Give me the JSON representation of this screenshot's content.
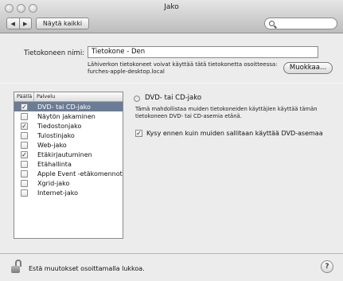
{
  "window": {
    "title": "Jako"
  },
  "toolbar": {
    "back_icon": "◀",
    "forward_icon": "▶",
    "show_all_label": "Näytä kaikki",
    "search_placeholder": ""
  },
  "computer_name": {
    "label": "Tietokoneen nimi:",
    "value": "Tietokone - Den",
    "help_line1": "Lähiverkon tietokoneet voivat käyttää tätä tietokonetta osoitteessa:",
    "help_line2": "furches-apple-desktop.local",
    "edit_label": "Muokkaa..."
  },
  "services": {
    "col_on": "Päällä",
    "col_service": "Palvelu",
    "items": [
      {
        "label": "DVD- tai CD-jako",
        "checked": "✓",
        "selected": true
      },
      {
        "label": "Näytön jakaminen",
        "checked": "",
        "selected": false
      },
      {
        "label": "Tiedostonjako",
        "checked": "✓",
        "selected": false
      },
      {
        "label": "Tulostinjako",
        "checked": "",
        "selected": false
      },
      {
        "label": "Web-jako",
        "checked": "",
        "selected": false
      },
      {
        "label": "Etäkirjautuminen",
        "checked": "✓",
        "selected": false
      },
      {
        "label": "Etähallinta",
        "checked": "",
        "selected": false
      },
      {
        "label": "Apple Event -etäkomennot",
        "checked": "",
        "selected": false
      },
      {
        "label": "Xgrid-jako",
        "checked": "",
        "selected": false
      },
      {
        "label": "Internet-jako",
        "checked": "",
        "selected": false
      }
    ]
  },
  "detail": {
    "title": "DVD- tai CD-jako",
    "desc_line1": "Tämä mahdollistaa muiden tietokoneiden käyttäjien käyttää tämän",
    "desc_line2": "tietokoneen DVD- tai CD-asemia etänä.",
    "ask_label": "Kysy ennen kuin muiden sallitaan käyttää DVD-asemaa",
    "ask_checked": "✓"
  },
  "footer": {
    "lock_label": "Estä muutokset osoittamalla lukkoa.",
    "help_label": "?"
  }
}
